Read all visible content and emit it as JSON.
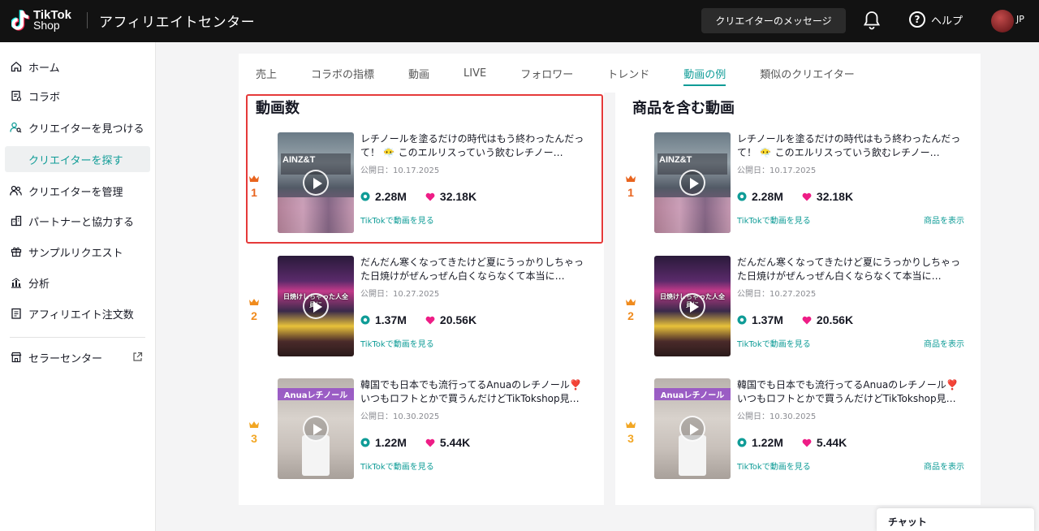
{
  "header": {
    "logo_line1": "TikTok",
    "logo_line2": "Shop",
    "app_title": "アフィリエイトセンター",
    "creator_messages": "クリエイターのメッセージ",
    "help": "ヘルプ",
    "lang": "JP"
  },
  "sidebar": {
    "items": [
      {
        "label": "ホーム",
        "icon": "home-icon"
      },
      {
        "label": "コラボ",
        "icon": "clipboard-icon"
      },
      {
        "label": "クリエイターを見つける",
        "icon": "find-user-icon"
      },
      {
        "label": "クリエイターを探す",
        "icon": ""
      },
      {
        "label": "クリエイターを管理",
        "icon": "users-icon"
      },
      {
        "label": "パートナーと協力する",
        "icon": "building-icon"
      },
      {
        "label": "サンプルリクエスト",
        "icon": "gift-icon"
      },
      {
        "label": "分析",
        "icon": "chart-icon"
      },
      {
        "label": "アフィリエイト注文数",
        "icon": "order-icon"
      },
      {
        "label": "セラーセンター",
        "icon": "store-icon"
      }
    ]
  },
  "tabs": [
    "売上",
    "コラボの指標",
    "動画",
    "LIVE",
    "フォロワー",
    "トレンド",
    "動画の例",
    "類似のクリエイター"
  ],
  "active_tab": "動画の例",
  "sections": {
    "left_title": "動画数",
    "right_title": "商品を含む動画"
  },
  "videos": [
    {
      "rank": "1",
      "title": "レチノールを塗るだけの時代はもう終わったんだって！ 😶‍🌫️ このエルリスっていう飲むレチノー…",
      "date_label": "公開日：",
      "date": "10.17.2025",
      "views": "2.28M",
      "likes": "32.18K",
      "rank_color": "#e8641e",
      "thumb_overlay": "AINZ&T"
    },
    {
      "rank": "2",
      "title": "だんだん寒くなってきたけど夏にうっかりしちゃった日焼けがぜんっぜん白くならなくて本当に…",
      "date_label": "公開日：",
      "date": "10.27.2025",
      "views": "1.37M",
      "likes": "20.56K",
      "rank_color": "#f08b1d",
      "thumb_overlay": "日焼けしちゃった人全員に"
    },
    {
      "rank": "3",
      "title": "韓国でも日本でも流行ってるAnuaのレチノール❣️ いつもロフトとかで買うんだけどTikTokshop見…",
      "date_label": "公開日：",
      "date": "10.30.2025",
      "views": "1.22M",
      "likes": "5.44K",
      "rank_color": "#f2a623",
      "thumb_overlay": "Anuaレチノール"
    }
  ],
  "links": {
    "watch_on_tiktok": "TikTokで動画を見る",
    "show_product": "商品を表示"
  },
  "chat_label": "チャット"
}
